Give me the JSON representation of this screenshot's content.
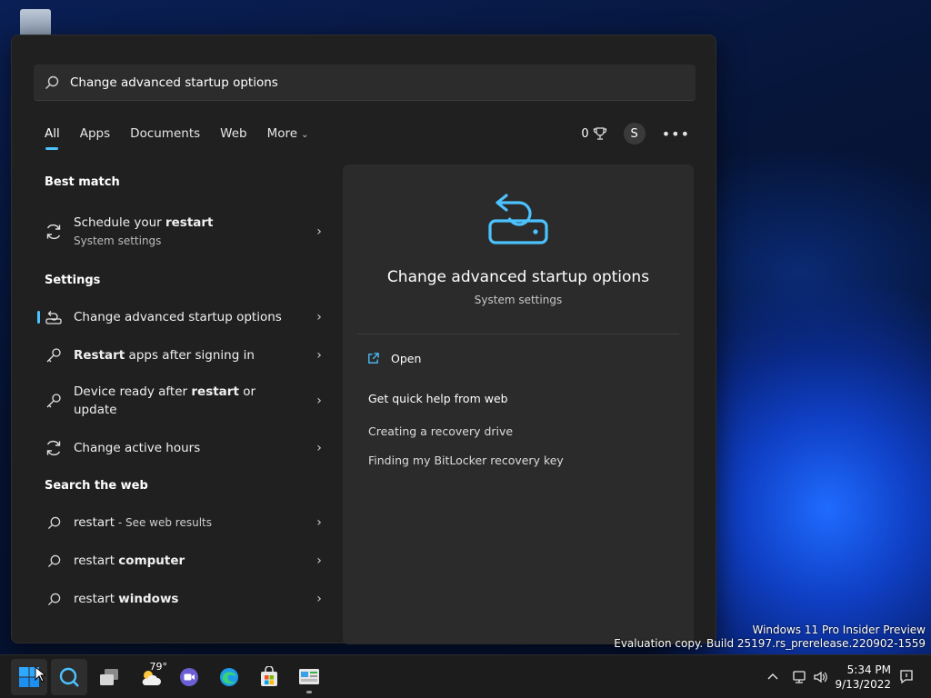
{
  "search": {
    "query": "Change advanced startup options"
  },
  "tabs": [
    {
      "label": "All"
    },
    {
      "label": "Apps"
    },
    {
      "label": "Documents"
    },
    {
      "label": "Web"
    },
    {
      "label": "More"
    }
  ],
  "toolbar": {
    "points": "0",
    "avatar_letter": "S"
  },
  "left": {
    "best_match_title": "Best match",
    "best_match": {
      "label_prefix": "Schedule your ",
      "label_bold": "restart",
      "sub": "System settings"
    },
    "settings_title": "Settings",
    "settings": [
      {
        "plain": "Change advanced startup options"
      },
      {
        "bold": "Restart",
        "plain": " apps after signing in"
      },
      {
        "line1_plain": "Device ready after ",
        "line1_bold": "restart",
        "line1_tail": " or",
        "line2": "update"
      },
      {
        "plain": "Change active hours"
      }
    ],
    "web_title": "Search the web",
    "web": [
      {
        "prefix": "restart",
        "bold": "",
        "suffix": " - See web results"
      },
      {
        "prefix": "restart ",
        "bold": "computer",
        "suffix": ""
      },
      {
        "prefix": "restart ",
        "bold": "windows",
        "suffix": ""
      }
    ]
  },
  "preview": {
    "title": "Change advanced startup options",
    "sub": "System settings",
    "open_label": "Open",
    "help_title": "Get quick help from web",
    "links": [
      "Creating a recovery drive",
      "Finding my BitLocker recovery key"
    ]
  },
  "watermark": {
    "line1": "Windows 11 Pro Insider Preview",
    "line2": "Evaluation copy. Build 25197.rs_prerelease.220902-1559"
  },
  "taskbar": {
    "weather_temp": "79°",
    "time": "5:34 PM",
    "date": "9/13/2022"
  },
  "colors": {
    "accent": "#4cc2ff",
    "panel": "#202020",
    "preview": "#2b2b2b"
  }
}
